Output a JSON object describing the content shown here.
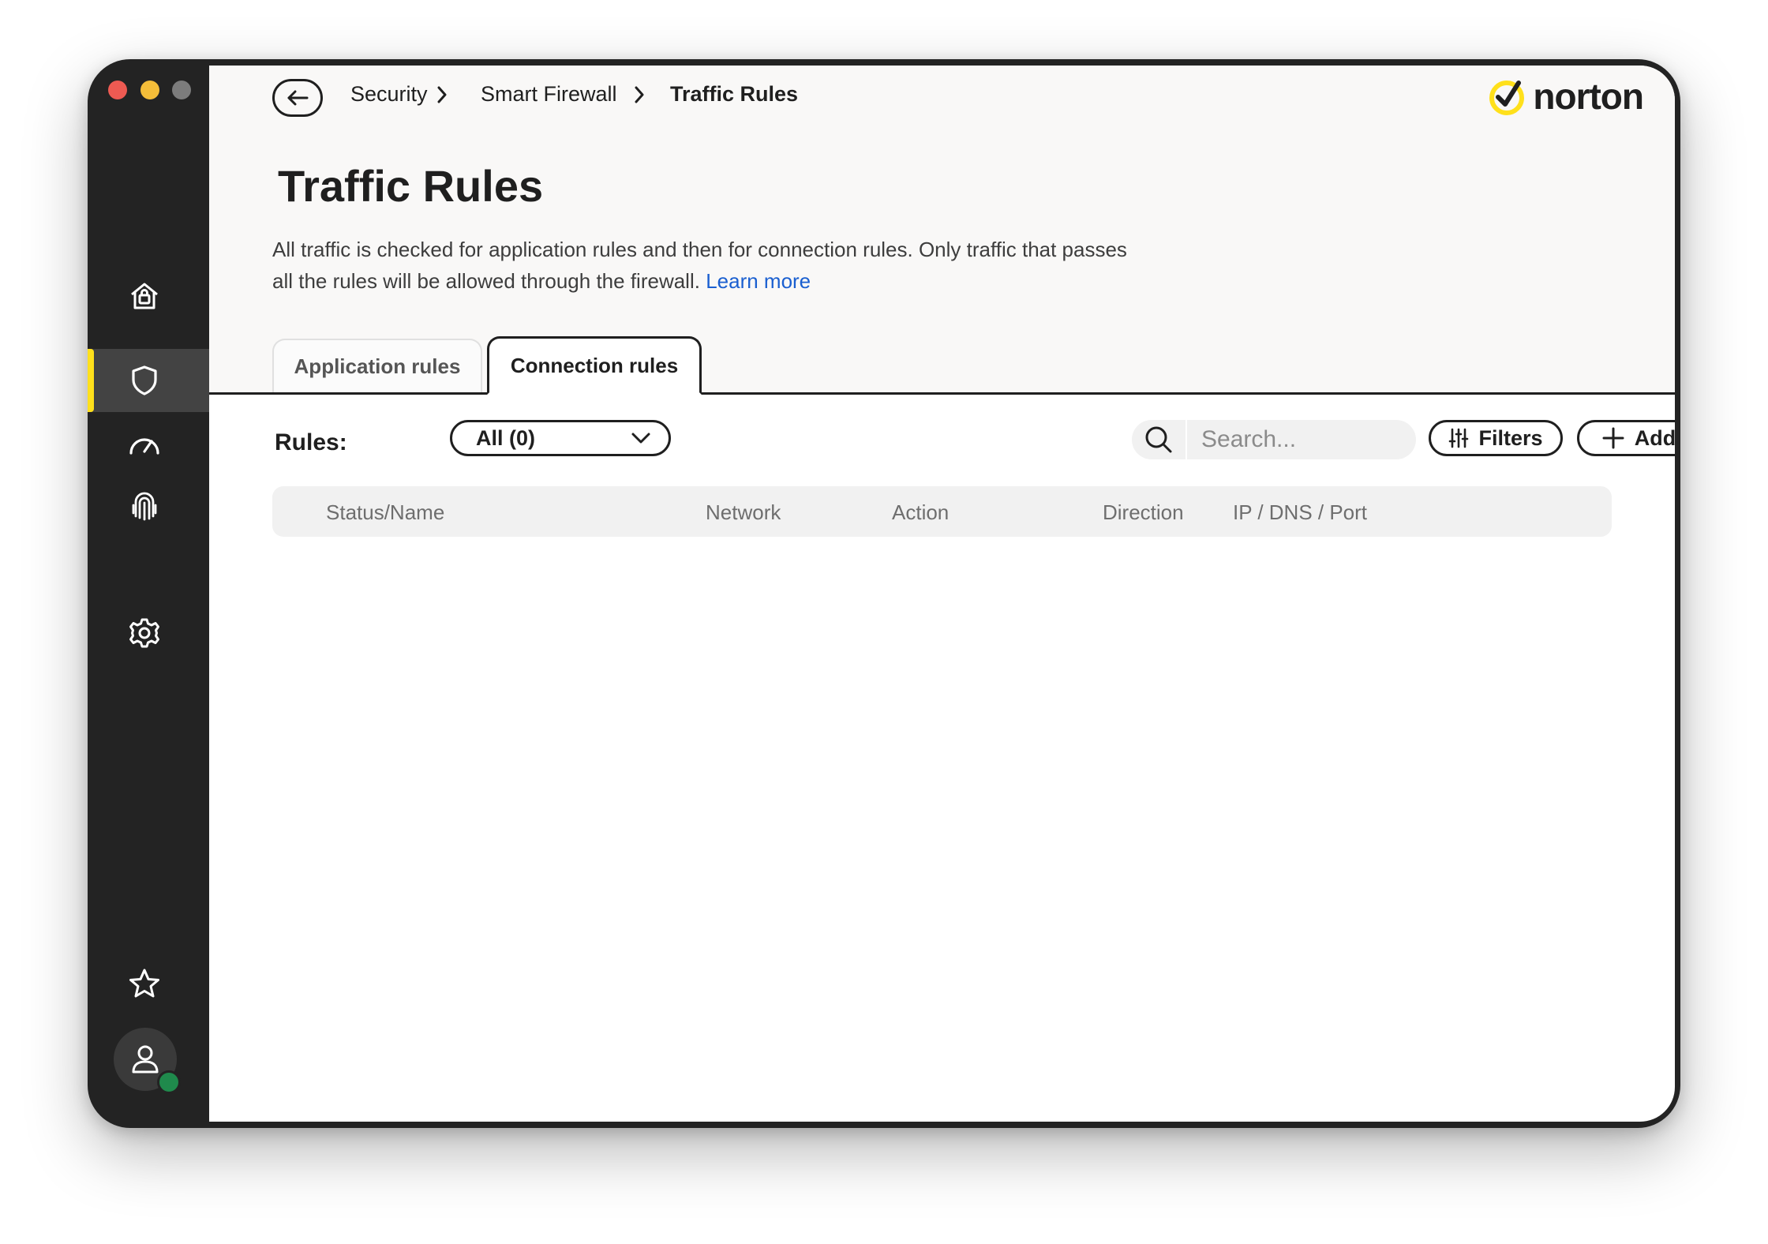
{
  "window": {
    "title": "Norton"
  },
  "sidebar": {
    "items": [
      {
        "id": "home",
        "icon": "home-lock-icon"
      },
      {
        "id": "security",
        "icon": "shield-icon",
        "active": true
      },
      {
        "id": "performance",
        "icon": "speedometer-icon"
      },
      {
        "id": "identity",
        "icon": "fingerprint-icon"
      },
      {
        "id": "settings",
        "icon": "gear-icon"
      },
      {
        "id": "favorites",
        "icon": "star-icon"
      },
      {
        "id": "account",
        "icon": "user-icon",
        "status": "online"
      }
    ],
    "accent": "#ffe01b",
    "status_color": "#1f8a4c"
  },
  "breadcrumb": {
    "items": [
      "Security",
      "Smart Firewall",
      "Traffic Rules"
    ]
  },
  "brand": {
    "name": "norton",
    "check_color": "#ffe01b"
  },
  "page": {
    "title": "Traffic Rules",
    "description": "All traffic is checked for application rules and then for connection rules. Only traffic that passes all the rules will be allowed through the firewall.",
    "learn_more": "Learn more",
    "link_color": "#1a5fd0"
  },
  "tabs": [
    {
      "label": "Application rules",
      "active": false
    },
    {
      "label": "Connection rules",
      "active": true
    }
  ],
  "toolbar": {
    "rules_label": "Rules:",
    "rules_select_value": "All (0)",
    "search_placeholder": "Search...",
    "filters_label": "Filters",
    "add_label": "Add"
  },
  "table": {
    "columns": [
      "Status/Name",
      "Network",
      "Action",
      "Direction",
      "IP / DNS / Port"
    ],
    "rows": []
  }
}
